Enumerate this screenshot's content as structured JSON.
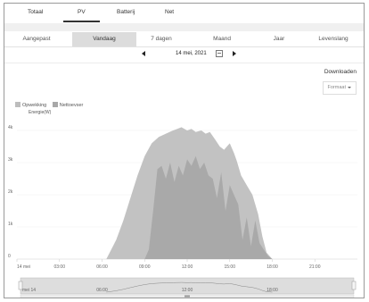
{
  "top_tabs": [
    {
      "label": "Totaal"
    },
    {
      "label": "PV",
      "active": true
    },
    {
      "label": "Batterij"
    },
    {
      "label": "Net"
    }
  ],
  "period_tabs": [
    {
      "label": "Aangepast"
    },
    {
      "label": "Vandaag",
      "active": true
    },
    {
      "label": "7 dagen"
    },
    {
      "label": "Maand"
    },
    {
      "label": "Jaar"
    },
    {
      "label": "Levenslang"
    }
  ],
  "date_nav": {
    "date": "14 mei, 2021"
  },
  "download": {
    "label": "Downloaden",
    "format_label": "Formaat"
  },
  "legend": [
    {
      "label": "Opwekking",
      "color": "#bdbdbd"
    },
    {
      "label": "Nettoevser",
      "color": "#a8a8a8"
    }
  ],
  "colors": {
    "generation": "#c2c2c2",
    "net": "#a9a9a9",
    "navigator": "#dddddd"
  },
  "chart_data": {
    "type": "area",
    "ylabel": "Energie(W)",
    "y_ticks": [
      "4k",
      "3k",
      "2k",
      "1k",
      "0"
    ],
    "y_tick_values": [
      4000,
      3000,
      2000,
      1000,
      0
    ],
    "x_ticks": [
      "14 mei",
      "03:00",
      "06:00",
      "09:00",
      "12:00",
      "15:00",
      "18:00",
      "21:00"
    ],
    "x_tick_hours": [
      0,
      3,
      6,
      9,
      12,
      15,
      18,
      21
    ],
    "ylim": [
      0,
      4500
    ],
    "xlim_hours": [
      0,
      24
    ],
    "series": [
      {
        "name": "Opwekking",
        "x": [
          6.3,
          7.0,
          7.5,
          8.0,
          8.5,
          9.0,
          9.5,
          10.0,
          10.5,
          11.0,
          11.3,
          11.6,
          12.0,
          12.3,
          12.6,
          13.0,
          13.3,
          13.6,
          14.0,
          14.3,
          14.6,
          15.0,
          15.3,
          15.5,
          15.8,
          16.2,
          16.6,
          17.0,
          17.3,
          17.6,
          18.0
        ],
        "y": [
          0,
          600,
          1200,
          1900,
          2600,
          3200,
          3600,
          3800,
          3900,
          4000,
          4050,
          4100,
          4000,
          4050,
          3950,
          4000,
          3900,
          3950,
          3700,
          3500,
          3400,
          3600,
          3300,
          3050,
          2600,
          2300,
          2000,
          1400,
          700,
          200,
          0
        ]
      },
      {
        "name": "Nettoevser",
        "x": [
          9.0,
          9.3,
          9.6,
          9.9,
          10.2,
          10.5,
          10.8,
          11.1,
          11.4,
          11.7,
          12.0,
          12.3,
          12.6,
          12.9,
          13.2,
          13.5,
          13.8,
          14.1,
          14.4,
          14.7,
          15.0,
          15.3,
          15.6,
          15.9,
          16.2,
          16.5,
          16.8,
          17.1,
          17.4,
          17.7,
          18.0
        ],
        "y": [
          0,
          300,
          1500,
          2800,
          2900,
          2500,
          3000,
          2400,
          2900,
          2600,
          3100,
          2900,
          3200,
          2800,
          3000,
          2600,
          2500,
          1900,
          2700,
          1500,
          2300,
          2000,
          1700,
          600,
          1300,
          400,
          1200,
          500,
          300,
          100,
          0
        ]
      }
    ],
    "navigator_x_ticks": [
      "mei 14",
      "06:00",
      "12:00",
      "18:00"
    ],
    "navigator_tick_hours": [
      0,
      6,
      12,
      18
    ]
  }
}
